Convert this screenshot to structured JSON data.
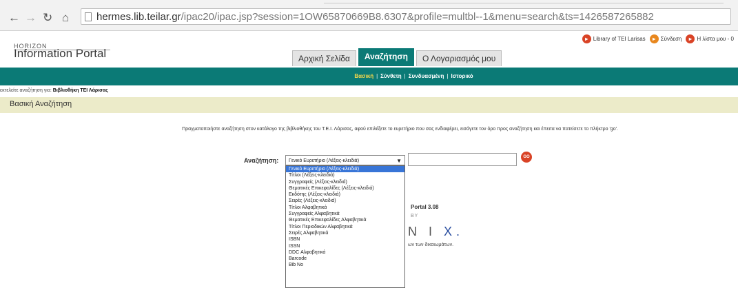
{
  "browser": {
    "url_host": "hermes.lib.teilar.gr",
    "url_path": "/ipac20/ipac.jsp?session=1OW65870669B8.6307&profile=multbl--1&menu=search&ts=1426587265882"
  },
  "header": {
    "logo_small": "HORIZON",
    "logo_main": "Information Portal",
    "links": [
      {
        "label": "Library of TEI Larisas",
        "color": "#d94326"
      },
      {
        "label": "Σύνδεση",
        "color": "#e8871e"
      },
      {
        "label": "Η λίστα μου - 0",
        "color": "#d94326"
      }
    ]
  },
  "tabs": [
    {
      "label": "Αρχική Σελίδα",
      "active": false
    },
    {
      "label": "Αναζήτηση",
      "active": true
    },
    {
      "label": "Ο Λογαριασμός μου",
      "active": false
    }
  ],
  "subnav": [
    {
      "label": "Βασική",
      "current": true
    },
    {
      "label": "Σύνθετη",
      "current": false
    },
    {
      "label": "Συνδυασμένη",
      "current": false
    },
    {
      "label": "Ιστορικό",
      "current": false
    }
  ],
  "crumb": {
    "prefix": "εκτελείτε αναζήτηση για:",
    "target": "Βιβλιοθήκη ΤΕΙ Λάρισας"
  },
  "page_title": "Βασική Αναζήτηση",
  "instructions": "Πραγματοποιήστε αναζήτηση στον κατάλογο της βιβλιοθήκης του Τ.Ε.Ι. Λάρισας, αφού επιλέξετε το ευρετήριο που σας ενδιαφέρει, εισάγετε τον όρο προς αναζήτηση και έπειτα να πατείσετε το πλήκτρο 'go'.",
  "search": {
    "label": "Αναζήτηση:",
    "selected": "Γενικό Ευρετήριο (Λέξεις-κλειδιά)",
    "go_label": "GO",
    "options": [
      "Γενικό Ευρετήριο (Λέξεις-κλειδιά)",
      "Τίτλοι (Λέξεις-κλειδιά)",
      "Συγγραφείς (Λέξεις-κλειδιά)",
      "Θεματικές Επικεφαλίδες (Λέξεις-κλειδιά)",
      "Εκδότης (Λέξεις-κλειδιά)",
      "Σειρές (Λέξεις-κλειδιά)",
      "Τίτλοι Αλφαβητικά",
      "Συγγραφείς Αλφαβητικά",
      "Θεματικές Επικεφαλίδες Αλφαβητικά",
      "Τίτλοι Περιοδικών Αλφαβητικά",
      "Σειρές Αλφαβητικά",
      "ISBN",
      "ISSN",
      "DDC Αλφαβητικά",
      "Barcode",
      "Bib No"
    ]
  },
  "footer": {
    "portal": "Portal 3.08",
    "by": "BY",
    "brand_part": "N I",
    "brand_x": "X.",
    "rights": "ων των δικαιωμάτων."
  }
}
